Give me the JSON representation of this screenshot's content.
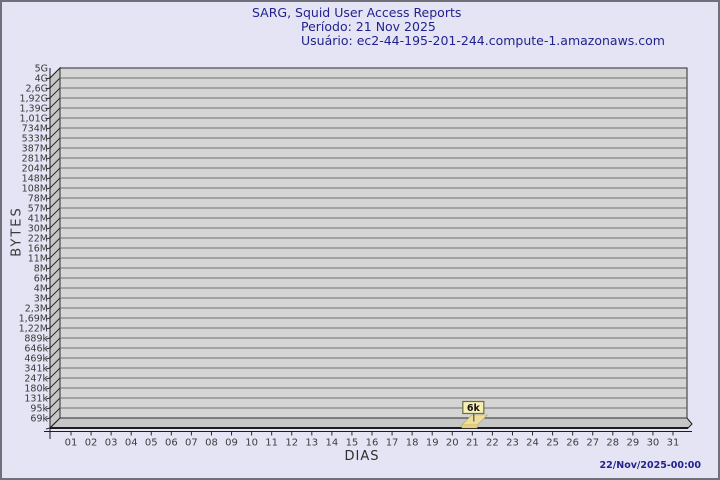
{
  "header": {
    "title": "SARG, Squid User Access Reports",
    "period_label": "Período: 21 Nov 2025",
    "user_label": "Usuário: ec2-44-195-201-244.compute-1.amazonaws.com"
  },
  "footer": {
    "generated_at": "22/Nov/2025-00:00"
  },
  "colors": {
    "background": "#e4e4f4",
    "title_text": "#22228e",
    "plot_background": "#d5d5d5",
    "wall": "#c7c7c7",
    "gridline": "#6e6e6e",
    "axis": "#1c1c1c",
    "tick_label": "#3a3a3a",
    "bar": "#eedf9a",
    "bar_front": "#e7d489",
    "bar_edge": "#b9a95a",
    "flag_background": "#f7f0b4",
    "flag_border": "#6b6b3c"
  },
  "chart_data": {
    "type": "bar",
    "title": "SARG, Squid User Access Reports",
    "subtitle_period": "Período: 21 Nov 2025",
    "subtitle_user": "Usuário: ec2-44-195-201-244.compute-1.amazonaws.com",
    "xlabel": "DIAS",
    "ylabel": "BYTES",
    "y_scale": "logarithmic",
    "grid": true,
    "y_tick_labels": [
      "5G",
      "4G",
      "2,6G",
      "1,92G",
      "1,39G",
      "1,01G",
      "734M",
      "533M",
      "387M",
      "281M",
      "204M",
      "148M",
      "108M",
      "78M",
      "57M",
      "41M",
      "30M",
      "22M",
      "16M",
      "11M",
      "8M",
      "6M",
      "4M",
      "3M",
      "2,3M",
      "1,69M",
      "1,22M",
      "889k",
      "646k",
      "469k",
      "341k",
      "247k",
      "180k",
      "131k",
      "95k",
      "69k"
    ],
    "x_categories": [
      "01",
      "02",
      "03",
      "04",
      "05",
      "06",
      "07",
      "08",
      "09",
      "10",
      "11",
      "12",
      "13",
      "14",
      "15",
      "16",
      "17",
      "18",
      "19",
      "20",
      "21",
      "22",
      "23",
      "24",
      "25",
      "26",
      "27",
      "28",
      "29",
      "30",
      "31"
    ],
    "bars": [
      {
        "day": "21",
        "value_label": "6k",
        "value": 6000
      }
    ]
  }
}
